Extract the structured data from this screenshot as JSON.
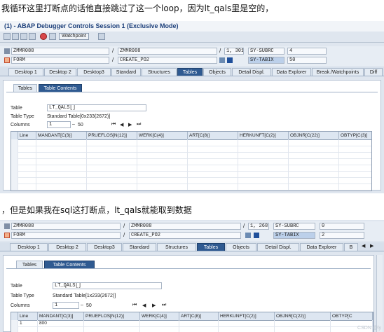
{
  "caption1": "我循环这里打断点的话他直接跳过了这一个loop，因为lt_qals里是空的，",
  "caption2": "，但是如果我在sql这打断点，lt_qals就能取到数据",
  "window_title": "(1) - ABAP Debugger Controls Session 1 (Exclusive Mode)",
  "toolbar": {
    "watchpoint_label": "Watchpoint"
  },
  "shots": [
    {
      "program1": "ZMMR088",
      "program2": "ZMMR088",
      "line_no": "1, 301",
      "sysvar1_name": "SY-SUBRC",
      "sysvar1_value": "4",
      "event_type": "FORM",
      "event_name": "CREATE_PO2",
      "sysvar2_name": "SY-TABIX",
      "sysvar2_value": "50",
      "tabs": [
        "Desktop 1",
        "Desktop 2",
        "Desktop3",
        "Standard",
        "Structures",
        "Tables",
        "Objects",
        "Detail Displ.",
        "Data Explorer",
        "Break./Watchpoints",
        "Diff"
      ],
      "active_tab": "Tables",
      "subtabs": [
        "Tables",
        "Table Contents"
      ],
      "table_label": "Table",
      "table_value": "LT_QALS[]",
      "type_label": "Table Type",
      "type_value": "Standard Table[0x233(2672)]",
      "columns_label": "Columns",
      "columns_from": "1",
      "columns_to": "50",
      "headers": [
        "Line",
        "MANDANT[C(3)]",
        "PRUEFLOS[N(12)]",
        "WERK[C(4)]",
        "ART[C(8)]",
        "HERKUNFT[C(2)]",
        "OBJNR[C(22)]",
        "OBTYP[C(3)]"
      ],
      "rows": []
    },
    {
      "program1": "ZMMR088",
      "program2": "ZMMR088",
      "line_no": "1, 268",
      "sysvar1_name": "SY-SUBRC",
      "sysvar1_value": "0",
      "event_type": "FORM",
      "event_name": "CREATE_PO2",
      "sysvar2_name": "SY-TABIX",
      "sysvar2_value": "2",
      "tabs": [
        "Desktop 1",
        "Desktop 2",
        "Desktop3",
        "Standard",
        "Structures",
        "Tables",
        "Objects",
        "Detail Displ.",
        "Data Explorer",
        "B"
      ],
      "active_tab": "Tables",
      "subtabs": [
        "Tables",
        "Table Contents"
      ],
      "table_label": "Table",
      "table_value": "LT_QALS[]",
      "type_label": "Table Type",
      "type_value": "Standard Table[1x233(2672)]",
      "columns_label": "Columns",
      "columns_from": "1",
      "columns_to": "50",
      "headers": [
        "Line",
        "MANDANT[C(3)]",
        "PRUEFLOS[N(12)]",
        "WERK[C(4)]",
        "ART[C(8)]",
        "HERKUNFT[C(2)]",
        "OBJNR[C(22)]",
        "OBTYP[C"
      ],
      "rows": [
        [
          "1",
          "800",
          "",
          "",
          "",
          "",
          "",
          ""
        ]
      ]
    }
  ],
  "watermark": "CSDN @ly"
}
